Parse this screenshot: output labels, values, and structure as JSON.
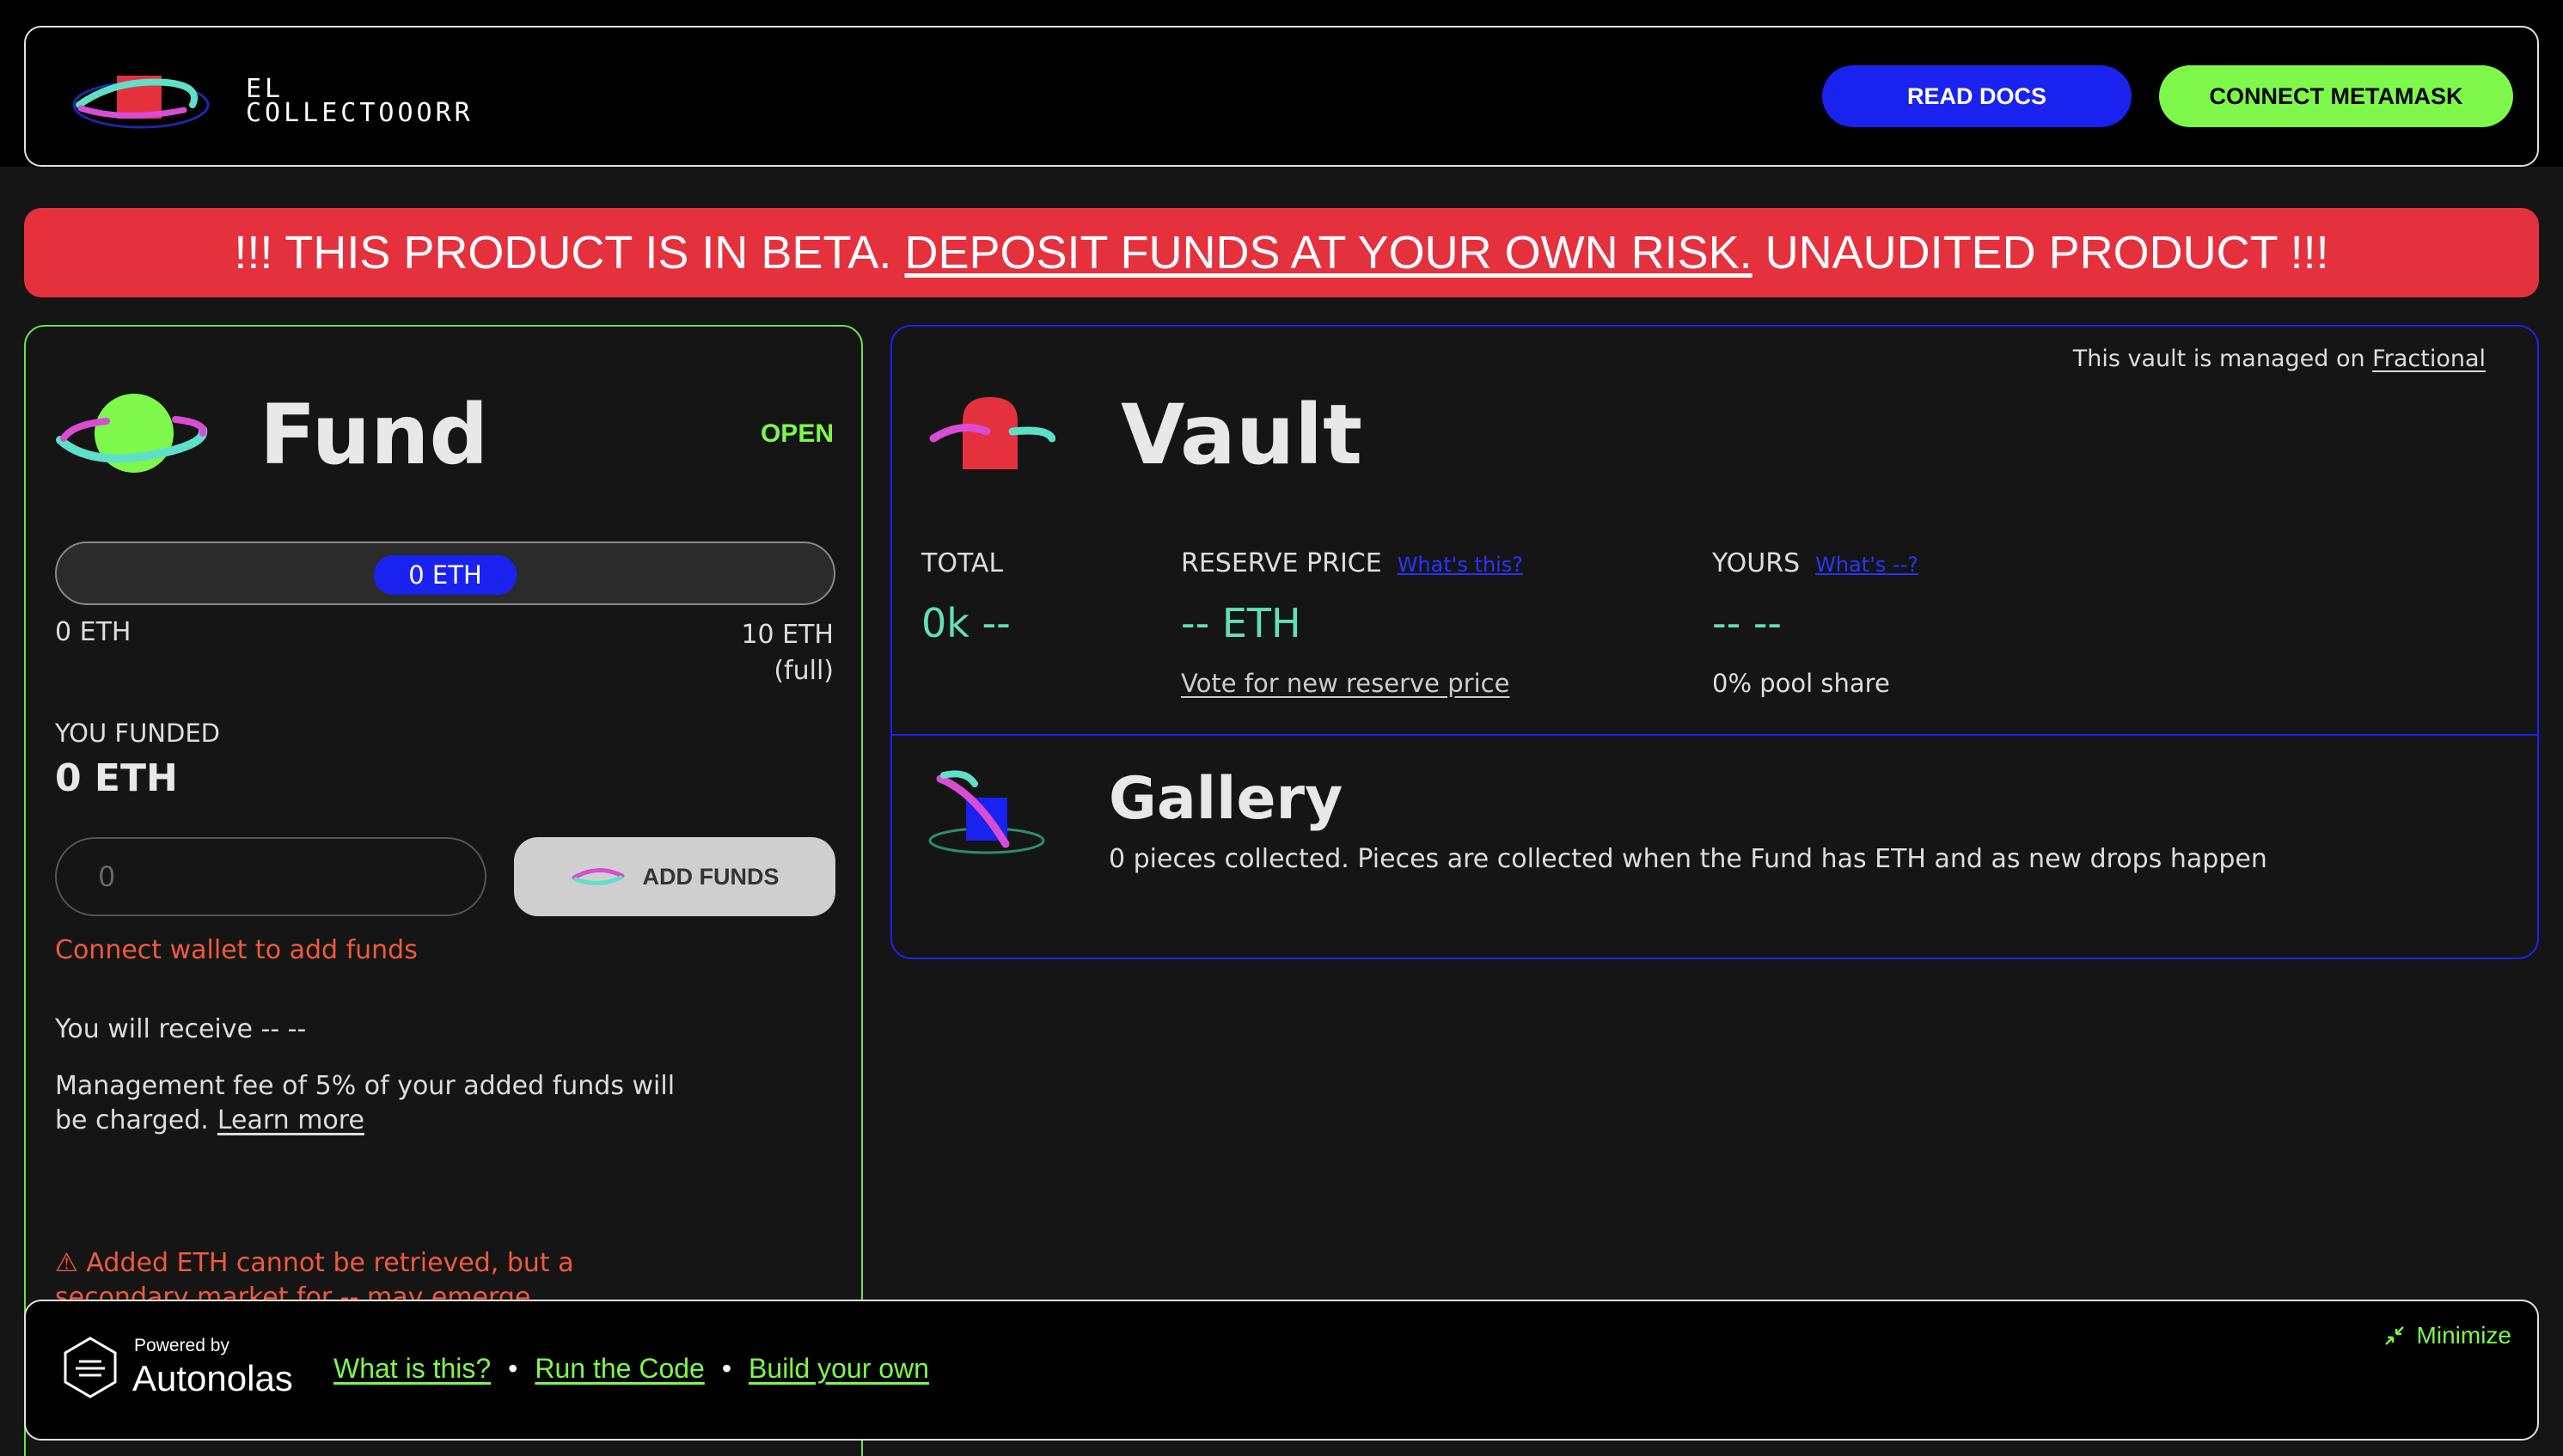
{
  "header": {
    "brand_line1": "EL",
    "brand_line2": "COLLECTOOORR",
    "read_docs_label": "READ DOCS",
    "connect_label": "CONNECT METAMASK"
  },
  "banner": {
    "prefix": "!!! THIS PRODUCT IS IN BETA. ",
    "link": "DEPOSIT FUNDS AT YOUR OWN RISK.",
    "suffix": " UNAUDITED PRODUCT !!!"
  },
  "fund": {
    "title": "Fund",
    "status": "OPEN",
    "progress_label": "0 ETH",
    "progress_fraction": 0,
    "range_min": "0 ETH",
    "range_max": "10 ETH",
    "range_max_note": "(full)",
    "funded_label": "YOU FUNDED",
    "funded_value": "0 ETH",
    "input_placeholder": "0",
    "add_funds_label": "ADD FUNDS",
    "connect_error": "Connect wallet to add funds",
    "receive_text": "You will receive -- --",
    "fee_text": "Management fee of 5% of your added funds will be charged.",
    "learn_more": "Learn more",
    "warning_text": "⚠ Added ETH cannot be retrieved, but a secondary market for -- may emerge"
  },
  "vault": {
    "managed_text": "This vault is managed on ",
    "managed_link": "Fractional",
    "title": "Vault",
    "total_label": "TOTAL",
    "total_value": "0k --",
    "reserve_label": "RESERVE PRICE",
    "reserve_help": "What's this?",
    "reserve_value": "-- ETH",
    "reserve_vote": "Vote for new reserve price",
    "yours_label": "YOURS",
    "yours_help": "What's --?",
    "yours_value": "-- --",
    "yours_share": "0% pool share"
  },
  "gallery": {
    "title": "Gallery",
    "subtitle": "0 pieces collected. Pieces are collected when the Fund has ETH and as new drops happen"
  },
  "footer": {
    "powered_by": "Powered by",
    "name": "Autonolas",
    "link1": "What is this?",
    "link2": "Run the Code",
    "link3": "Build your own",
    "separator": "•",
    "minimize": "Minimize"
  },
  "colors": {
    "accent_green": "#7ef84a",
    "accent_blue": "#1a22f0",
    "banner_red": "#e5313e",
    "value_teal": "#62e0b6",
    "error_orange": "#ef5a3a"
  }
}
